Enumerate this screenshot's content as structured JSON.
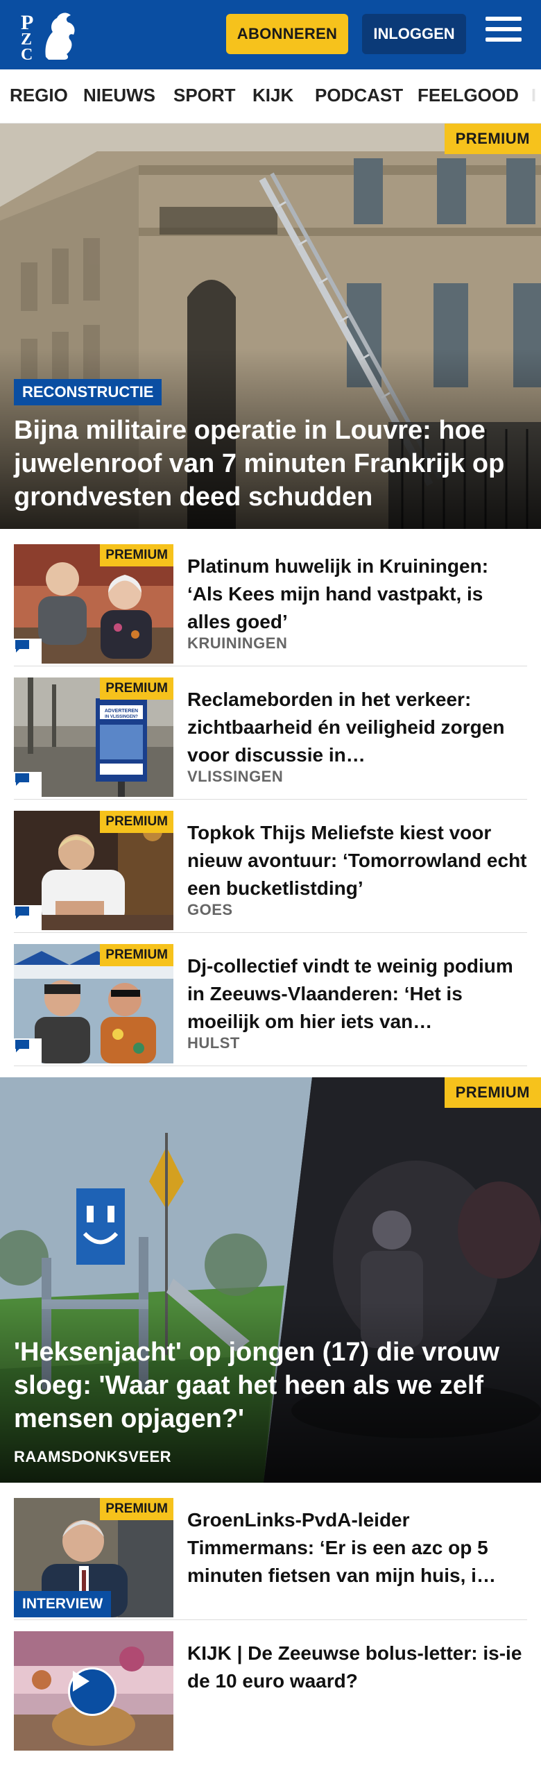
{
  "header": {
    "logo_text": "PZC",
    "subscribe_label": "ABONNEREN",
    "login_label": "INLOGGEN",
    "menu_icon": "hamburger-menu-icon",
    "brand_color": "#0a4ea2",
    "accent_color": "#f6c21c"
  },
  "nav": {
    "items": [
      "REGIO",
      "NIEUWS",
      "SPORT",
      "KIJK",
      "PODCAST",
      "FEELGOOD"
    ]
  },
  "hero1": {
    "premium": "PREMIUM",
    "tag": "RECONSTRUCTIE",
    "title": "Bijna militaire operatie in Louvre: hoe juwelenroof van 7 minuten Frankrijk op grondvesten deed schudden"
  },
  "articles": [
    {
      "premium": "PREMIUM",
      "title": "Platinum huwelijk in Kruiningen: ‘Als Kees mijn hand vastpakt, is alles goed’",
      "location": "KRUININGEN"
    },
    {
      "premium": "PREMIUM",
      "title": "Reclameborden in het verkeer: zichtbaarheid én veiligheid zorgen voor discussie in…",
      "location": "VLISSINGEN",
      "sign_text_1": "ADVERTEREN",
      "sign_text_2": "IN VLISSINGEN?"
    },
    {
      "premium": "PREMIUM",
      "title": "Topkok Thijs Meliefste kiest voor nieuw avontuur: ‘Tomorrowland echt een bucketlistding’",
      "location": "GOES"
    },
    {
      "premium": "PREMIUM",
      "title": "Dj-collectief vindt te weinig podium in Zeeuws-Vlaanderen: ‘Het is moeilijk om hier iets van…",
      "location": "HULST"
    }
  ],
  "hero2": {
    "premium": "PREMIUM",
    "title": "'Heksenjacht' op jongen (17) die vrouw sloeg: 'Waar gaat het heen als we zelf mensen opjagen?'",
    "location": "RAAMSDONKSVEER"
  },
  "articles2": [
    {
      "premium": "PREMIUM",
      "badge": "INTERVIEW",
      "title": "GroenLinks-PvdA-leider Timmermans: ‘Er is een azc op 5 minuten fietsen van mijn huis, i…"
    },
    {
      "title": "KIJK | De Zeeuwse bolus-letter: is-ie de 10 euro waard?",
      "icon": "play-icon"
    }
  ]
}
